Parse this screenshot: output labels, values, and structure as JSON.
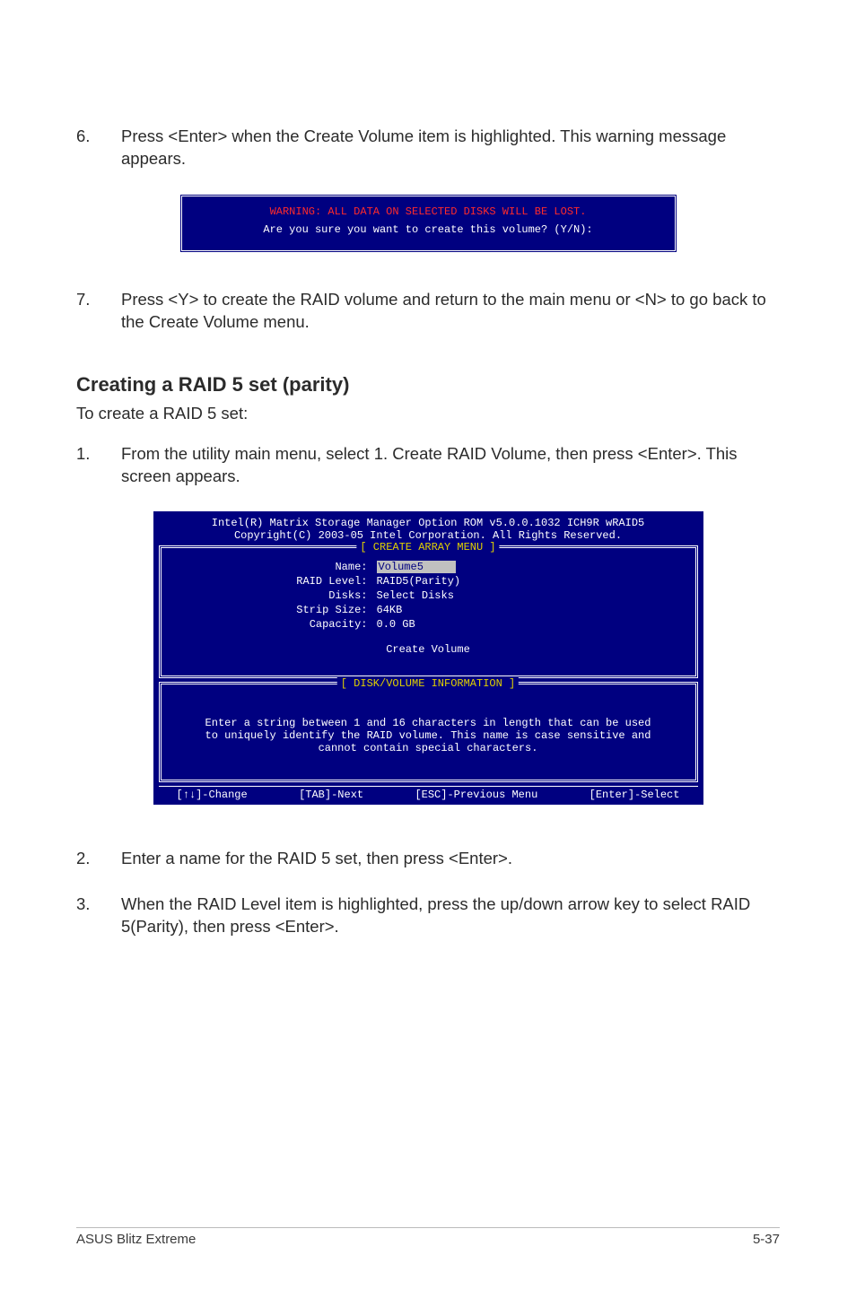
{
  "step6": {
    "num": "6.",
    "text": "Press <Enter> when the Create Volume item is highlighted. This warning message appears."
  },
  "warning_box": {
    "warn": "WARNING: ALL DATA ON SELECTED DISKS WILL BE LOST.",
    "prompt": "Are you sure you want to create this volume? (Y/N):"
  },
  "step7": {
    "num": "7.",
    "text": "Press <Y> to create the RAID volume and return to the main menu or <N> to go back to the Create Volume menu."
  },
  "section_heading": "Creating a RAID 5 set (parity)",
  "section_intro": "To create a RAID 5 set:",
  "step1": {
    "num": "1.",
    "text": "From the utility main menu, select 1. Create RAID Volume, then press <Enter>. This screen appears."
  },
  "bios": {
    "header_line1": "Intel(R) Matrix Storage Manager Option ROM v5.0.0.1032 ICH9R wRAID5",
    "header_line2": "Copyright(C) 2003-05 Intel Corporation. All Rights Reserved.",
    "panel1_title": "[ CREATE ARRAY MENU ]",
    "fields": {
      "name_k": "Name:",
      "name_v": "Volume5",
      "raid_k": "RAID Level:",
      "raid_v": "RAID5(Parity)",
      "disks_k": "Disks:",
      "disks_v": "Select Disks",
      "strip_k": "Strip Size:",
      "strip_v": "64KB",
      "cap_k": "Capacity:",
      "cap_v": "0.0  GB"
    },
    "create_volume": "Create Volume",
    "panel2_title": "[ DISK/VOLUME INFORMATION ]",
    "info_text": "Enter a string between 1 and 16 characters in length that can be used\nto uniquely identify the RAID volume. This name is case sensitive and\ncannot contain special characters.",
    "footer": {
      "change": "[↑↓]-Change",
      "next": "[TAB]-Next",
      "prev": "[ESC]-Previous Menu",
      "select": "[Enter]-Select"
    }
  },
  "step2": {
    "num": "2.",
    "text": "Enter a name for the RAID 5 set, then press <Enter>."
  },
  "step3": {
    "num": "3.",
    "text": "When the RAID Level item is highlighted, press the up/down arrow key to select RAID 5(Parity), then press <Enter>."
  },
  "footer": {
    "left": "ASUS Blitz Extreme",
    "right": "5-37"
  }
}
